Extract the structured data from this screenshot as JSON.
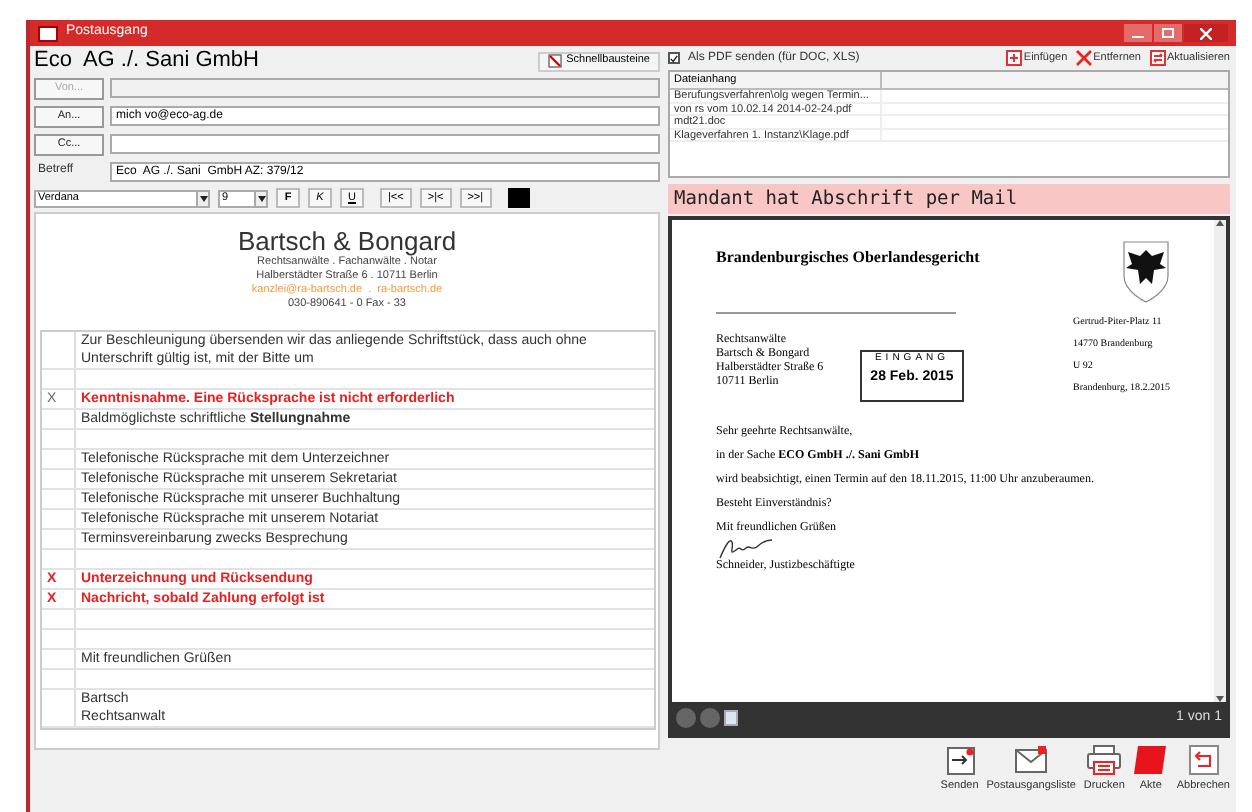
{
  "window": {
    "title": "Postausgang"
  },
  "header": {
    "title": "Eco  AG ./. Sani GmbH",
    "quick_button": "Schnellbausteine"
  },
  "address_fields": [
    {
      "button": "Von...",
      "disabled": true
    },
    {
      "button": "An...",
      "value": "mich vo@eco-ag.de",
      "disabled": false
    },
    {
      "button": "Cc...",
      "disabled": false
    }
  ],
  "subject": {
    "label": "Betreff",
    "value": "Eco  AG ./. Sani  GmbH AZ: 379/12"
  },
  "format_toolbar": {
    "font": "Verdana",
    "size": "9",
    "buttons": [
      "F",
      "K",
      "U",
      "|<<",
      ">|<",
      ">>|"
    ]
  },
  "letterhead": {
    "name": "Bartsch & Bongard",
    "lines": [
      {
        "kind": "plain",
        "text": "Rechtsanwälte . Fachanwälte . Notar"
      },
      {
        "kind": "plain",
        "text": "Halberstädter Straße 6 . 10711 Berlin"
      },
      {
        "kind": "link",
        "text": "kanzlei@ra-bartsch.de  .  ra-bartsch.de"
      },
      {
        "kind": "plain",
        "text": "030-890641 - 0 Fax - 33"
      }
    ]
  },
  "rows": [
    {
      "kind": "text",
      "text": "Zur Beschleunigung übersenden wir das anliegende Schriftstück, dass auch ohne Unterschrift gültig ist,  mit der Bitte um",
      "important": false
    },
    {
      "kind": "empty"
    },
    {
      "kind": "text",
      "mark": "X",
      "mark_important": false,
      "text": "Kenntnisnahme. Eine Rücksprache ist nicht erforderlich",
      "important": true
    },
    {
      "kind": "text",
      "text": "Baldmöglichste schriftliche **Stellungnahme**",
      "important": false
    },
    {
      "kind": "empty"
    },
    {
      "kind": "text",
      "text": "Telefonische Rücksprache mit dem Unterzeichner",
      "important": false
    },
    {
      "kind": "text",
      "text": "Telefonische Rücksprache mit unserem Sekretariat",
      "important": false
    },
    {
      "kind": "text",
      "text": "Telefonische Rücksprache mit unserer Buchhaltung",
      "important": false
    },
    {
      "kind": "text",
      "text": "Telefonische Rücksprache mit unserem Notariat",
      "important": false
    },
    {
      "kind": "text",
      "text": "Terminsvereinbarung zwecks Besprechung",
      "important": false
    },
    {
      "kind": "empty"
    },
    {
      "kind": "text",
      "mark": "X",
      "mark_important": true,
      "text": "Unterzeichnung und Rücksendung",
      "important": true
    },
    {
      "kind": "text",
      "mark": "X",
      "mark_important": true,
      "text": "Nachricht, sobald Zahlung erfolgt ist",
      "important": true
    },
    {
      "kind": "empty"
    },
    {
      "kind": "empty"
    },
    {
      "kind": "text",
      "text": "Mit freundlichen Grüßen",
      "important": false
    },
    {
      "kind": "empty"
    },
    {
      "kind": "lines",
      "lines": [
        "Bartsch",
        "Rechtsanwalt"
      ]
    }
  ],
  "pdf_option": {
    "label": "Als PDF senden (für DOC, XLS)",
    "checked": true
  },
  "attachment_actions": [
    {
      "kind": "insert",
      "label": "Einfügen"
    },
    {
      "kind": "remove",
      "label": "Entfernen"
    },
    {
      "kind": "refresh",
      "label": "Aktualisieren"
    }
  ],
  "attachments": {
    "column": "Dateianhang",
    "rows": [
      "Berufungsverfahren\\olg wegen Termin...",
      "von rs vom 10.02.14 2014-02-24.pdf",
      "mdt21.doc",
      "Klageverfahren 1. Instanz\\Klage.pdf"
    ]
  },
  "notice": "Mandant hat Abschrift per Mail",
  "preview": {
    "document": {
      "court": "Brandenburgisches Oberlandesgericht",
      "recipient": [
        "Rechtsanwälte",
        "Bartsch & Bongard",
        "Halberstädter Straße 6",
        "10711 Berlin"
      ],
      "stamp": {
        "title": "EINGANG",
        "date": "28 Feb. 2015"
      },
      "sidebar": [
        "Gertrud-Piter-Platz 11",
        "14770 Brandenburg",
        "U 92",
        "Brandenburg, 18.2.2015"
      ],
      "body": [
        "Sehr geehrte Rechtsanwälte,",
        "in der Sache **ECO GmbH ./. Sani GmbH**",
        "wird beabsichtigt, einen Termin auf den 18.11.2015, 11:00 Uhr anzuberaumen.",
        "Besteht Einverständnis?",
        "Mit freundlichen Grüßen"
      ],
      "signer": "Schneider, Justizbeschäftigte"
    },
    "page_label": "1 von 1"
  },
  "footer_buttons": [
    {
      "kind": "send",
      "label": "Senden"
    },
    {
      "kind": "outbox",
      "label": "Postausgangsliste"
    },
    {
      "kind": "print",
      "label": "Drucken"
    },
    {
      "kind": "file",
      "label": "Akte"
    },
    {
      "kind": "cancel",
      "label": "Abbrechen"
    }
  ]
}
